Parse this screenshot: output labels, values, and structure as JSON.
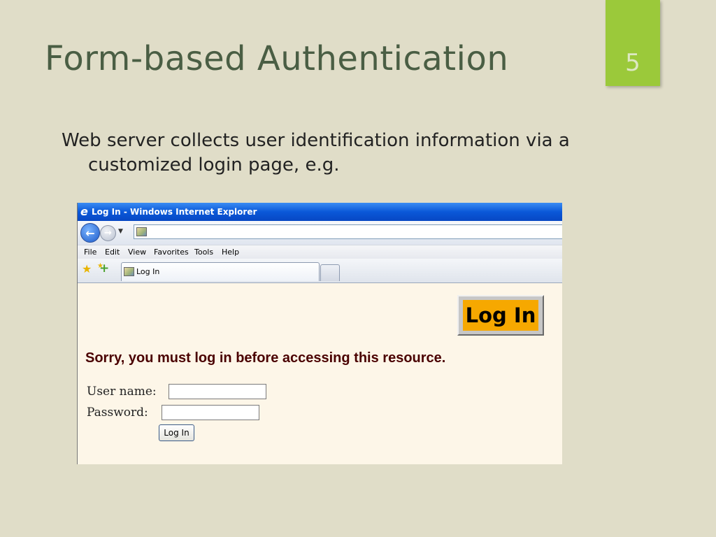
{
  "slide": {
    "title": "Form-based Authentication",
    "page_number": "5",
    "body_line1": "Web server collects user identification information via a",
    "body_line2": "customized login page, e.g.",
    "accent_color": "#9bc93a"
  },
  "browser": {
    "window_title": "Log In - Windows Internet Explorer",
    "address_value": "",
    "menu": [
      "File",
      "Edit",
      "View",
      "Favorites",
      "Tools",
      "Help"
    ],
    "tab_label": "Log In",
    "titlebar_color": "#0a58d8"
  },
  "page": {
    "logo_text": "Log In",
    "logo_color": "#f6a800",
    "error_message": "Sorry, you must log in before accessing this resource.",
    "username_label": "User name:",
    "username_value": "",
    "password_label": "Password:",
    "password_value": "",
    "submit_label": "Log In",
    "background_color": "#fdf6e8"
  },
  "icons": {
    "ie_logo": "ie-logo-icon",
    "back": "back-arrow-icon",
    "forward": "forward-arrow-icon",
    "page": "page-icon",
    "favorites": "star-icon",
    "add_favorite": "add-favorite-icon"
  }
}
